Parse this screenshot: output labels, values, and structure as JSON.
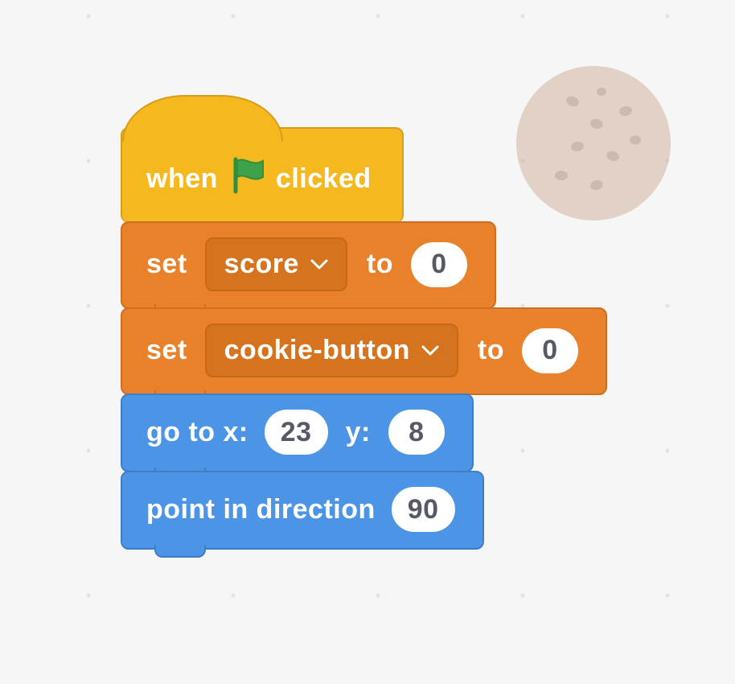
{
  "hat": {
    "prefix": "when",
    "suffix": "clicked",
    "icon": "green-flag-icon"
  },
  "blocks": {
    "set1": {
      "op": "set",
      "variable": "score",
      "to_label": "to",
      "value": "0"
    },
    "set2": {
      "op": "set",
      "variable": "cookie-button",
      "to_label": "to",
      "value": "0"
    },
    "goto": {
      "prefix": "go to x:",
      "x": "23",
      "mid": "y:",
      "y": "8"
    },
    "point": {
      "prefix": "point in direction",
      "value": "90"
    }
  },
  "colors": {
    "event": "#f5b91f",
    "variables": "#e9802a",
    "motion": "#4c95e6",
    "flag": "#2e8f3e"
  }
}
